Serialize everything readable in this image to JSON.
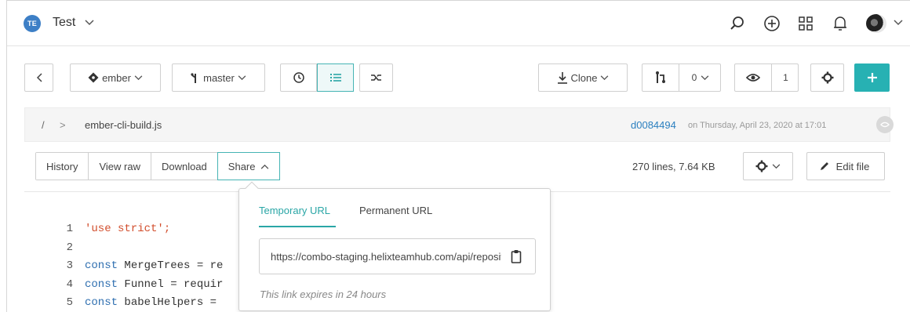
{
  "header": {
    "workspace_initials": "TE",
    "workspace_name": "Test",
    "icons": [
      "search-icon",
      "add-circle-icon",
      "apps-grid-icon",
      "bell-icon",
      "user-avatar"
    ]
  },
  "toolbar": {
    "repo_label": "ember",
    "branch_label": "master",
    "clone_label": "Clone",
    "pull_requests_count": "0",
    "watchers_count": "1"
  },
  "breadcrumb": {
    "root": "/",
    "separator": ">",
    "file": "ember-cli-build.js",
    "commit_hash": "d0084494",
    "commit_meta": "on Thursday, April 23, 2020 at 17:01"
  },
  "file_toolbar": {
    "history": "History",
    "view_raw": "View raw",
    "download": "Download",
    "share": "Share",
    "stats": "270 lines, 7.64 KB",
    "edit_file": "Edit file"
  },
  "share_popover": {
    "tab_temporary": "Temporary URL",
    "tab_permanent": "Permanent URL",
    "url": "https://combo-staging.helixteamhub.com/api/repositories/ember/files/ember-cli-build.js",
    "expiry_note": "This link expires in 24 hours"
  },
  "code": {
    "lines": [
      {
        "n": "1",
        "kw": "",
        "s": "'use strict';",
        "rest": ""
      },
      {
        "n": "2",
        "kw": "",
        "s": "",
        "rest": ""
      },
      {
        "n": "3",
        "kw": "const",
        "s": "",
        "rest": " MergeTrees = re"
      },
      {
        "n": "4",
        "kw": "const",
        "s": "",
        "rest": " Funnel = requir"
      },
      {
        "n": "5",
        "kw": "const",
        "s": "",
        "rest": " babelHelpers = "
      }
    ]
  },
  "colors": {
    "accent": "#27b1b3",
    "link": "#2a7fbf",
    "keyword": "#2f6fb0",
    "string": "#d24e2d"
  }
}
